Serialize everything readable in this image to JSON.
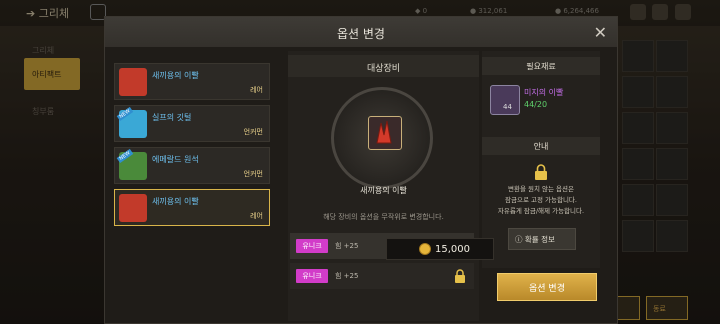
{
  "topbar": {
    "back_label": "그리체",
    "currency_items": [
      {
        "icon": "gem-icon",
        "value": "0"
      },
      {
        "icon": "coin-icon",
        "value": "312,061"
      },
      {
        "icon": "gold-icon",
        "value": "6,264,466"
      }
    ]
  },
  "left_tabs": [
    "그리체",
    "아티팩트",
    "칭부룸"
  ],
  "modal": {
    "title": "옵션 변경",
    "items": [
      {
        "name": "새끼용의 이빨",
        "grade": "레어",
        "color": "#c23a2a",
        "is_new": false,
        "selected": false
      },
      {
        "name": "실프의 깃털",
        "grade": "언커먼",
        "color": "#3aa8d6",
        "is_new": true,
        "selected": false
      },
      {
        "name": "에메랄드 원석",
        "grade": "언커먼",
        "color": "#4a8a3a",
        "is_new": true,
        "selected": false
      },
      {
        "name": "새끼용의 이빨",
        "grade": "레어",
        "color": "#c23a2a",
        "is_new": false,
        "selected": true
      }
    ],
    "new_tag": "NEW",
    "target": {
      "title": "대상장비",
      "item_name": "새끼용의 이빨",
      "description": "해당 장비의 옵션을 무작위로 변경합니다.",
      "options": [
        {
          "badge": "유니크",
          "text": "힘 +25",
          "locked": false
        },
        {
          "badge": "유니크",
          "text": "힘 +25",
          "locked": true
        }
      ]
    },
    "materials": {
      "title": "필요재료",
      "item_name": "미지의 이빨",
      "item_count": "44",
      "quantity": "44/20"
    },
    "guide": {
      "title": "안내",
      "lines": [
        "변환을 원치 않는 옵션은",
        "잠금으로 고정 가능합니다.",
        "자유롭게 잠금/해제 가능합니다."
      ],
      "prob_label": "확률 정보"
    },
    "cost": "15,000",
    "action_label": "옵션 변경",
    "close_icon": "close-icon"
  },
  "background_buttons": [
    "체력",
    "동료"
  ],
  "colors": {
    "accent": "#c9a23a",
    "unique_badge": "#d23cc9",
    "material_name": "#c46ee8",
    "material_qty": "#5fd06b",
    "item_name": "#6ec1ef"
  }
}
